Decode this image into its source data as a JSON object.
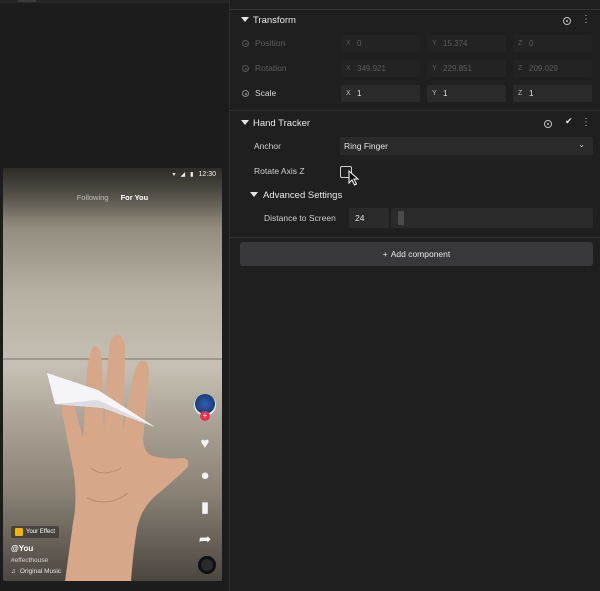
{
  "preview": {
    "status": {
      "time": "12:30"
    },
    "tabs": {
      "following": "Following",
      "for_you": "For You"
    },
    "caption": {
      "effect_label": "Your Effect",
      "user": "@You",
      "hashtag": "#effecthouse",
      "music": "Original Music"
    },
    "rail_icons": [
      "avatar",
      "heart-icon",
      "comment-icon",
      "bookmark-icon",
      "share-icon"
    ]
  },
  "inspector": {
    "transform": {
      "title": "Transform",
      "position": {
        "label": "Position",
        "x": "0",
        "y": "15.374",
        "z": "0"
      },
      "rotation": {
        "label": "Rotation",
        "x": "349.921",
        "y": "229.851",
        "z": "209.029"
      },
      "scale": {
        "label": "Scale",
        "x": "1",
        "y": "1",
        "z": "1"
      },
      "axes": {
        "x": "X",
        "y": "Y",
        "z": "Z"
      }
    },
    "hand_tracker": {
      "title": "Hand Tracker",
      "anchor_label": "Anchor",
      "anchor_value": "Ring Finger",
      "rotate_axis_label": "Rotate Axis Z",
      "rotate_axis_checked": false,
      "advanced_title": "Advanced Settings",
      "distance_label": "Distance to Screen",
      "distance_value": "24",
      "distance_fraction": 0.02
    },
    "add_component": {
      "plus": "+",
      "label": "Add component"
    }
  },
  "colors": {
    "panel_bg": "#1f1f20",
    "field_bg": "#2a2a2b",
    "button_bg": "#38383a",
    "notify_red": "#e8304e",
    "effect_chip": "#f4b400"
  }
}
